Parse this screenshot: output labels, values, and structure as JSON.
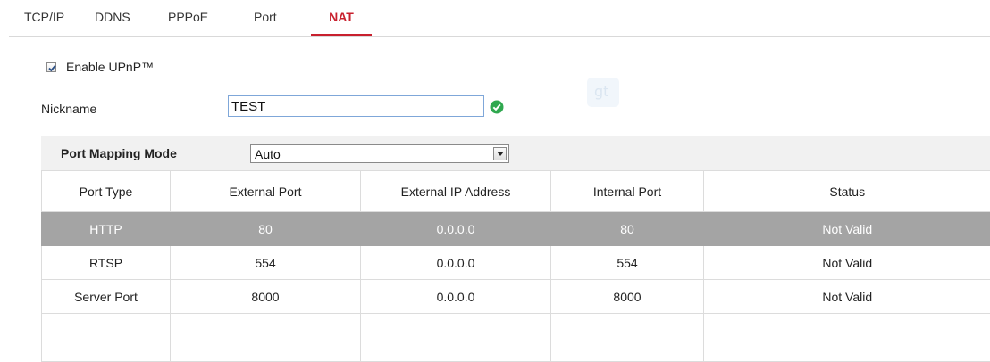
{
  "tabs": [
    {
      "label": "TCP/IP",
      "active": false
    },
    {
      "label": "DDNS",
      "active": false
    },
    {
      "label": "PPPoE",
      "active": false
    },
    {
      "label": "Port",
      "active": false
    },
    {
      "label": "NAT",
      "active": true
    }
  ],
  "upnp": {
    "label": "Enable UPnP™",
    "checked": true
  },
  "nickname": {
    "label": "Nickname",
    "value": "TEST",
    "status_icon": "check-circle-icon"
  },
  "port_mapping": {
    "label": "Port Mapping Mode",
    "selected": "Auto"
  },
  "table": {
    "columns": [
      "Port Type",
      "External Port",
      "External IP Address",
      "Internal Port",
      "Status"
    ],
    "rows": [
      {
        "port_type": "HTTP",
        "external_port": "80",
        "external_ip": "0.0.0.0",
        "internal_port": "80",
        "status": "Not Valid",
        "selected": true
      },
      {
        "port_type": "RTSP",
        "external_port": "554",
        "external_ip": "0.0.0.0",
        "internal_port": "554",
        "status": "Not Valid",
        "selected": false
      },
      {
        "port_type": "Server Port",
        "external_port": "8000",
        "external_ip": "0.0.0.0",
        "internal_port": "8000",
        "status": "Not Valid",
        "selected": false
      }
    ]
  },
  "colors": {
    "accent": "#c8202e",
    "selected_row": "#a4a4a4",
    "valid": "#2fa84f"
  }
}
